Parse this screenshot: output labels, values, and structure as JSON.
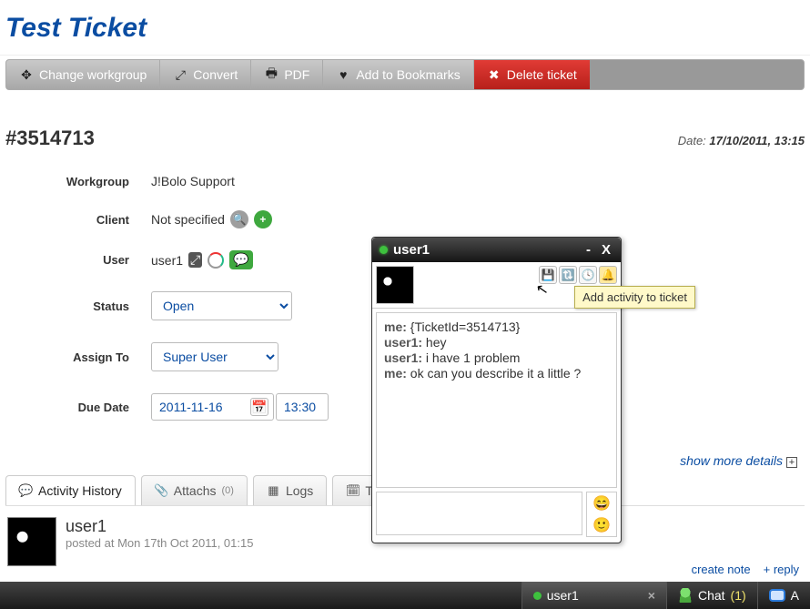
{
  "title": "Test Ticket",
  "toolbar": {
    "change_workgroup": "Change workgroup",
    "convert": "Convert",
    "pdf": "PDF",
    "bookmarks": "Add to Bookmarks",
    "delete": "Delete ticket"
  },
  "ticket": {
    "number_display": "#3514713",
    "date_label": "Date:",
    "date_value": "17/10/2011, 13:15"
  },
  "form": {
    "workgroup": {
      "label": "Workgroup",
      "value": "J!Bolo Support"
    },
    "client": {
      "label": "Client",
      "value": "Not specified"
    },
    "user": {
      "label": "User",
      "value": "user1"
    },
    "status": {
      "label": "Status",
      "value": "Open"
    },
    "assign": {
      "label": "Assign To",
      "value": "Super User"
    },
    "due": {
      "label": "Due Date",
      "date": "2011-11-16",
      "time": "13:30"
    }
  },
  "more_details": "show more details",
  "tabs": {
    "activity": "Activity History",
    "attachs": "Attachs",
    "attachs_count": "(0)",
    "logs": "Logs",
    "tasks": "Tas"
  },
  "activity": {
    "user": "user1",
    "posted": "posted at Mon 17th Oct 2011, 01:15"
  },
  "reply": {
    "create_note": "create note",
    "reply": "+ reply"
  },
  "chat": {
    "title": "user1",
    "tooltip": "Add activity to ticket",
    "messages": [
      {
        "who": "me:",
        "text": "{TicketId=3514713}"
      },
      {
        "who": "user1:",
        "text": "hey"
      },
      {
        "who": "user1:",
        "text": "i have 1 problem"
      },
      {
        "who": "me:",
        "text": "ok can you describe it a little ?"
      }
    ]
  },
  "bottombar": {
    "user_tab": "user1",
    "chat_label": "Chat",
    "chat_count": "(1)",
    "right": "A"
  }
}
